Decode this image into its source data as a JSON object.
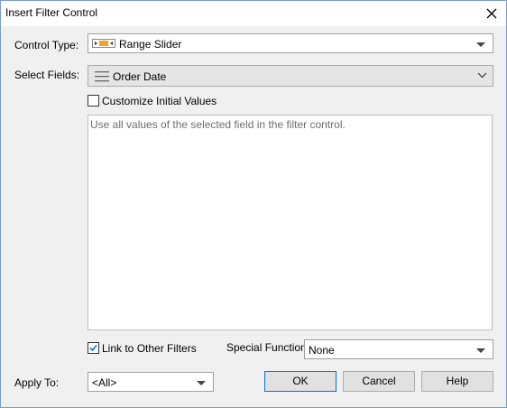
{
  "window": {
    "title": "Insert Filter Control"
  },
  "control_type": {
    "label": "Control Type:",
    "value": "Range Slider",
    "icon": "range-slider-icon"
  },
  "select_fields": {
    "label": "Select Fields:",
    "value": "Order Date",
    "icon": "field-list-icon"
  },
  "customize": {
    "label": "Customize Initial Values",
    "checked": false
  },
  "description": "Use all values of the selected field in the filter control.",
  "link_filters": {
    "label": "Link to Other Filters",
    "checked": true
  },
  "special_function": {
    "label": "Special Function:",
    "value": "None"
  },
  "apply_to": {
    "label": "Apply To:",
    "value": "<All>"
  },
  "buttons": {
    "ok": "OK",
    "cancel": "Cancel",
    "help": "Help"
  },
  "colors": {
    "accent": "#0078d7",
    "slider": "#f5a31a"
  }
}
